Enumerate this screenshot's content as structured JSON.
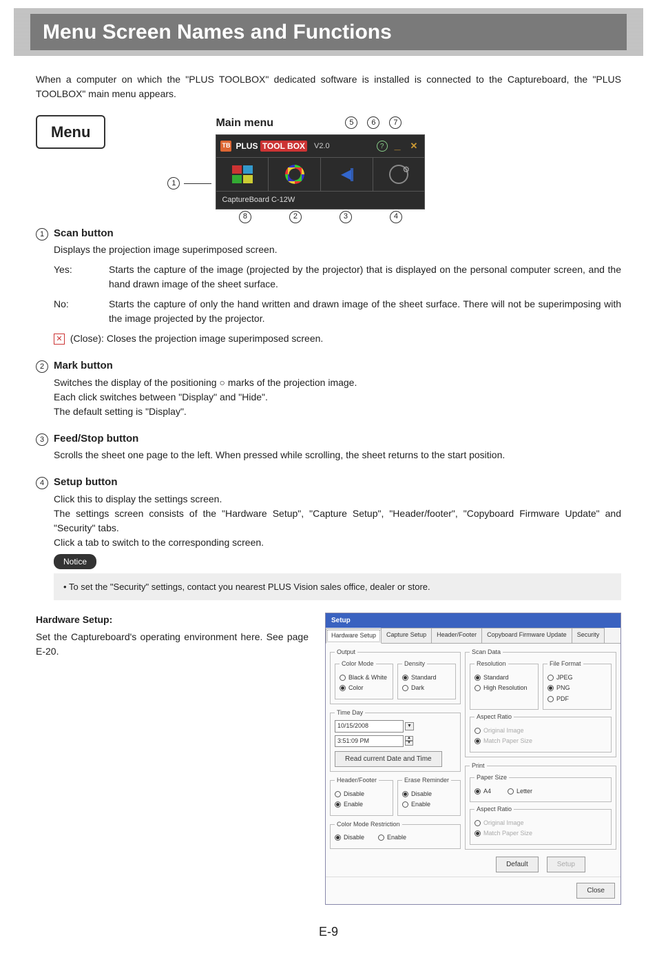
{
  "page_title": "Menu Screen Names and Functions",
  "intro": "When a computer on which the \"PLUS TOOLBOX\" dedicated software is installed is connected to the Captureboard, the \"PLUS TOOLBOX\" main menu appears.",
  "menu_label": "Menu",
  "main_menu_label": "Main menu",
  "window": {
    "brand_plus": "PLUS",
    "brand_tool": "TOOL BOX",
    "version": "V2.0",
    "status": "CaptureBoard C-12W"
  },
  "callouts": {
    "top": [
      "5",
      "6",
      "7"
    ],
    "left": "1",
    "bottom": [
      "8",
      "2",
      "3",
      "4"
    ]
  },
  "sections": [
    {
      "num": "1",
      "title": "Scan button",
      "lead": "Displays the projection image superimposed screen.",
      "yes_label": "Yes:",
      "yes_text": "Starts the capture of the image (projected by the projector) that is displayed on the personal computer screen, and the hand drawn image of the sheet surface.",
      "no_label": "No:",
      "no_text": "Starts the capture of only the hand written and drawn image of the sheet surface. There will not be superimposing with the image projected by the projector.",
      "close_label": "(Close):",
      "close_text": "Closes the projection image superimposed screen."
    },
    {
      "num": "2",
      "title": "Mark button",
      "body": "Switches the display of the positioning ○ marks of the projection image.\nEach click switches between \"Display\" and \"Hide\".\nThe default setting is \"Display\"."
    },
    {
      "num": "3",
      "title": "Feed/Stop button",
      "body": "Scrolls the sheet one page to the left. When pressed while scrolling, the sheet returns to the start position."
    },
    {
      "num": "4",
      "title": "Setup button",
      "body": "Click this to display the settings screen.\nThe settings screen consists of the \"Hardware Setup\", \"Capture Setup\",  \"Header/footer\", \"Copyboard Firmware Update\" and \"Security\" tabs.\nClick a tab to switch to the corresponding screen."
    }
  ],
  "notice_label": "Notice",
  "notice_text": "To set the \"Security\" settings, contact you nearest PLUS Vision sales office, dealer or store.",
  "hardware_setup": {
    "title": "Hardware Setup:",
    "text": "Set the Captureboard's operating environment here. See page E-20."
  },
  "dialog": {
    "title": "Setup",
    "tabs": [
      "Hardware Setup",
      "Capture Setup",
      "Header/Footer",
      "Copyboard Firmware Update",
      "Security"
    ],
    "output": {
      "legend": "Output",
      "color_mode": {
        "legend": "Color Mode",
        "bw": "Black & White",
        "color": "Color"
      },
      "density": {
        "legend": "Density",
        "standard": "Standard",
        "dark": "Dark"
      }
    },
    "time_day": {
      "legend": "Time Day",
      "date": "10/15/2008",
      "time": "3:51:09 PM",
      "read_btn": "Read current Date and Time"
    },
    "header_footer": {
      "legend": "Header/Footer",
      "disable": "Disable",
      "enable": "Enable"
    },
    "erase_reminder": {
      "legend": "Erase Reminder",
      "disable": "Disable",
      "enable": "Enable"
    },
    "color_restrict": {
      "legend": "Color Mode Restriction",
      "disable": "Disable",
      "enable": "Enable"
    },
    "scan_data": {
      "legend": "Scan Data",
      "resolution": {
        "legend": "Resolution",
        "standard": "Standard",
        "high": "High Resolution"
      },
      "file_format": {
        "legend": "File Format",
        "jpeg": "JPEG",
        "png": "PNG",
        "pdf": "PDF"
      },
      "aspect": {
        "legend": "Aspect Ratio",
        "orig": "Original Image",
        "match": "Match Paper Size"
      }
    },
    "print": {
      "legend": "Print",
      "paper_size": {
        "legend": "Paper Size",
        "a4": "A4",
        "letter": "Letter"
      },
      "aspect": {
        "legend": "Aspect Ratio",
        "orig": "Original Image",
        "match": "Match Paper Size"
      }
    },
    "buttons": {
      "default": "Default",
      "setup": "Setup",
      "close": "Close"
    }
  },
  "page_number": "E-9"
}
